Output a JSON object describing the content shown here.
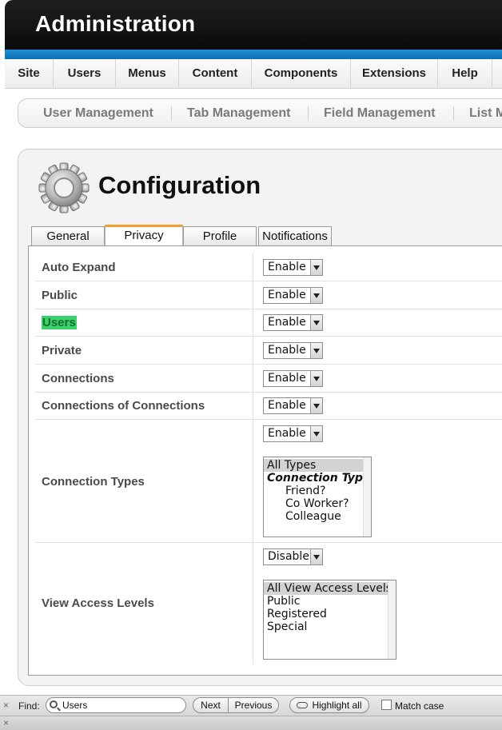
{
  "header": {
    "title": "Administration"
  },
  "menu": {
    "items": [
      "Site",
      "Users",
      "Menus",
      "Content",
      "Components",
      "Extensions",
      "Help"
    ]
  },
  "submenu": {
    "items": [
      "User Management",
      "Tab Management",
      "Field Management",
      "List M"
    ]
  },
  "page": {
    "title": "Configuration",
    "icon": "gear-icon"
  },
  "tabs": [
    {
      "label": "General",
      "active": false
    },
    {
      "label": "Privacy",
      "active": true
    },
    {
      "label": "Profile",
      "active": false
    },
    {
      "label": "Notifications",
      "active": false
    }
  ],
  "settings": {
    "auto_expand": {
      "label": "Auto Expand",
      "value": "Enable"
    },
    "public": {
      "label": "Public",
      "value": "Enable"
    },
    "users": {
      "label": "Users",
      "value": "Enable"
    },
    "private": {
      "label": "Private",
      "value": "Enable"
    },
    "connections": {
      "label": "Connections",
      "value": "Enable"
    },
    "connections_of_connections": {
      "label": "Connections of Connections",
      "value": "Enable"
    },
    "connection_types": {
      "label": "Connection Types",
      "value": "Enable",
      "options": [
        "All Types",
        "Connection Types",
        "Friend?",
        "Co Worker?",
        "Colleague"
      ]
    },
    "view_access_levels": {
      "label": "View Access Levels",
      "value": "Disable",
      "options": [
        "All View Access Levels",
        "Public",
        "Registered",
        "Special"
      ]
    }
  },
  "findbar": {
    "label": "Find:",
    "query": "Users",
    "next": "Next",
    "previous": "Previous",
    "highlight_all": "Highlight all",
    "match_case": "Match case",
    "close_glyph": "×"
  },
  "colors": {
    "header_bg": "#111111",
    "accent_stripe": "#1a86cc",
    "active_tab": "#f0a030",
    "find_highlight": "#38d26a"
  }
}
